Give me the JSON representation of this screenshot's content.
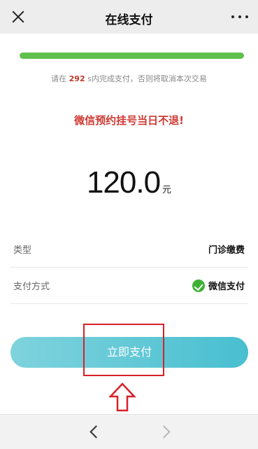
{
  "header": {
    "title": "在线支付",
    "close_icon": "close-icon",
    "more_icon": "more-icon"
  },
  "progress": {
    "fraction": 1.0,
    "color": "#5fc04e"
  },
  "countdown": {
    "prefix": "请在 ",
    "seconds": "292",
    "suffix": " s内完成支付，否则将取消本次交易"
  },
  "notice": "微信预约挂号当日不退!",
  "amount": {
    "value": "120.0",
    "unit": "元"
  },
  "details": [
    {
      "key": "类型",
      "value": "门诊缴费"
    },
    {
      "key": "支付方式",
      "value": "微信支付",
      "icon": "wechat-pay-icon"
    }
  ],
  "pay_button": {
    "label": "立即支付"
  },
  "bottom_nav": {
    "back_icon": "back-icon",
    "forward_icon": "forward-icon"
  },
  "colors": {
    "accent": "#4fc2d2",
    "warning": "#cf3a34",
    "highlight": "#d8202a"
  }
}
